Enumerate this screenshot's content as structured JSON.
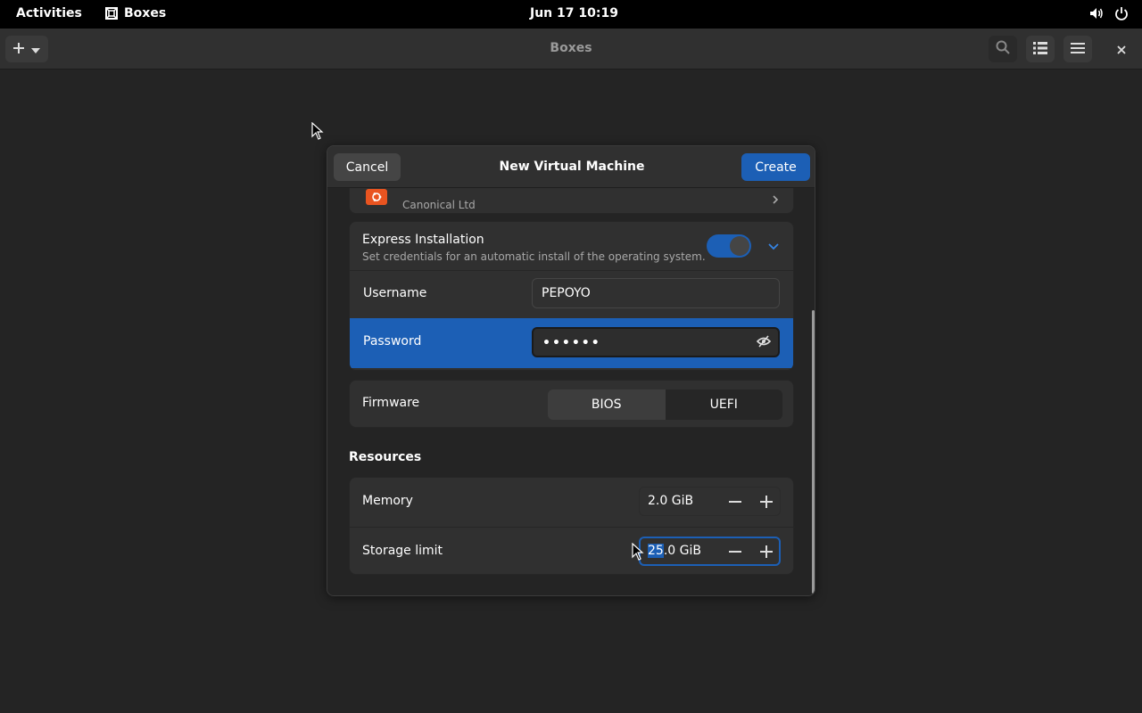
{
  "topbar": {
    "activities": "Activities",
    "app_name": "Boxes",
    "clock": "Jun 17  10:19"
  },
  "headerbar": {
    "title": "Boxes"
  },
  "dialog": {
    "title": "New Virtual Machine",
    "cancel_label": "Cancel",
    "create_label": "Create",
    "os_vendor": "Canonical Ltd",
    "express": {
      "title": "Express Installation",
      "subtitle": "Set credentials for an automatic install of the operating system.",
      "enabled": true,
      "username_label": "Username",
      "username_value": "PEPOYO",
      "password_label": "Password",
      "password_masked": "••••••"
    },
    "firmware": {
      "label": "Firmware",
      "options": [
        "BIOS",
        "UEFI"
      ],
      "selected": "BIOS"
    },
    "resources": {
      "section_title": "Resources",
      "memory_label": "Memory",
      "memory_value": "2.0 GiB",
      "storage_label": "Storage limit",
      "storage_value_selected": "25",
      "storage_value_rest": ".0 GiB"
    }
  },
  "colors": {
    "accent": "#1c5fb5",
    "ubuntu_orange": "#e95420",
    "background": "#242424"
  }
}
